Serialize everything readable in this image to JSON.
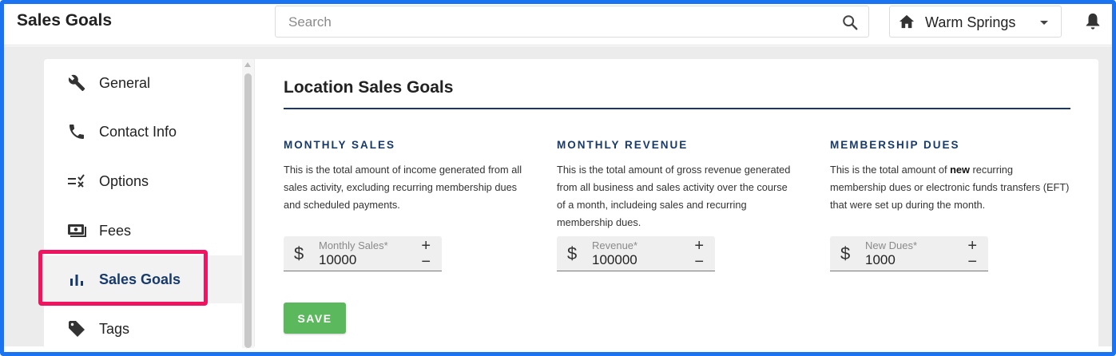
{
  "app": {
    "title": "Sales Goals"
  },
  "search": {
    "placeholder": "Search",
    "value": "",
    "icon": "search-icon"
  },
  "location": {
    "name": "Warm Springs",
    "icon": "home-icon"
  },
  "notifications": {
    "icon": "bell-icon"
  },
  "sidebar": {
    "items": [
      {
        "label": "General",
        "icon": "wrench-icon",
        "active": false
      },
      {
        "label": "Contact Info",
        "icon": "phone-icon",
        "active": false
      },
      {
        "label": "Options",
        "icon": "options-list-icon",
        "active": false
      },
      {
        "label": "Fees",
        "icon": "money-icon",
        "active": false
      },
      {
        "label": "Sales Goals",
        "icon": "bar-chart-icon",
        "active": true
      },
      {
        "label": "Tags",
        "icon": "tag-icon",
        "active": false
      }
    ]
  },
  "main": {
    "title": "Location Sales Goals",
    "goals": [
      {
        "heading": "MONTHLY SALES",
        "desc_parts": [
          "This is the total amount of income generated from all sales activity, excluding recurring membership dues and scheduled payments."
        ],
        "field_label": "Monthly Sales*",
        "field_value": "10000",
        "currency": "$"
      },
      {
        "heading": "MONTHLY REVENUE",
        "desc_parts": [
          "This is the total amount of gross revenue generated from all business and sales activity over the course of a month, includeing sales and recurring membership dues."
        ],
        "field_label": "Revenue*",
        "field_value": "100000",
        "currency": "$"
      },
      {
        "heading": "MEMBERSHIP DUES",
        "desc_parts": [
          "This is the total amount of ",
          "new",
          " recurring membership dues or electronic funds transfers (EFT) that were set up during the month."
        ],
        "field_label": "New Dues*",
        "field_value": "1000",
        "currency": "$"
      }
    ],
    "plus_label": "+",
    "minus_label": "−",
    "save_label": "SAVE"
  },
  "colors": {
    "frame": "#1a73f0",
    "highlight": "#f0135f",
    "accent_navy": "#173a6b",
    "save_green": "#5cb85c"
  }
}
